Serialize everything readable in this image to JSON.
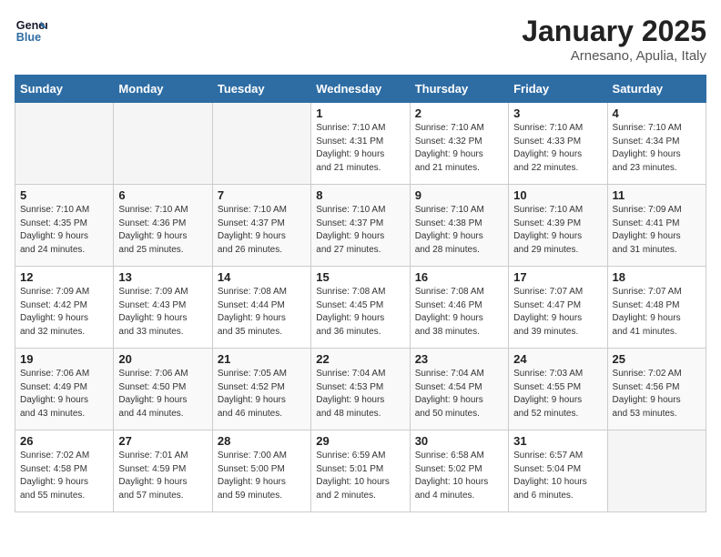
{
  "header": {
    "logo_line1": "General",
    "logo_line2": "Blue",
    "month": "January 2025",
    "location": "Arnesano, Apulia, Italy"
  },
  "weekdays": [
    "Sunday",
    "Monday",
    "Tuesday",
    "Wednesday",
    "Thursday",
    "Friday",
    "Saturday"
  ],
  "weeks": [
    [
      {
        "day": "",
        "info": ""
      },
      {
        "day": "",
        "info": ""
      },
      {
        "day": "",
        "info": ""
      },
      {
        "day": "1",
        "info": "Sunrise: 7:10 AM\nSunset: 4:31 PM\nDaylight: 9 hours\nand 21 minutes."
      },
      {
        "day": "2",
        "info": "Sunrise: 7:10 AM\nSunset: 4:32 PM\nDaylight: 9 hours\nand 21 minutes."
      },
      {
        "day": "3",
        "info": "Sunrise: 7:10 AM\nSunset: 4:33 PM\nDaylight: 9 hours\nand 22 minutes."
      },
      {
        "day": "4",
        "info": "Sunrise: 7:10 AM\nSunset: 4:34 PM\nDaylight: 9 hours\nand 23 minutes."
      }
    ],
    [
      {
        "day": "5",
        "info": "Sunrise: 7:10 AM\nSunset: 4:35 PM\nDaylight: 9 hours\nand 24 minutes."
      },
      {
        "day": "6",
        "info": "Sunrise: 7:10 AM\nSunset: 4:36 PM\nDaylight: 9 hours\nand 25 minutes."
      },
      {
        "day": "7",
        "info": "Sunrise: 7:10 AM\nSunset: 4:37 PM\nDaylight: 9 hours\nand 26 minutes."
      },
      {
        "day": "8",
        "info": "Sunrise: 7:10 AM\nSunset: 4:37 PM\nDaylight: 9 hours\nand 27 minutes."
      },
      {
        "day": "9",
        "info": "Sunrise: 7:10 AM\nSunset: 4:38 PM\nDaylight: 9 hours\nand 28 minutes."
      },
      {
        "day": "10",
        "info": "Sunrise: 7:10 AM\nSunset: 4:39 PM\nDaylight: 9 hours\nand 29 minutes."
      },
      {
        "day": "11",
        "info": "Sunrise: 7:09 AM\nSunset: 4:41 PM\nDaylight: 9 hours\nand 31 minutes."
      }
    ],
    [
      {
        "day": "12",
        "info": "Sunrise: 7:09 AM\nSunset: 4:42 PM\nDaylight: 9 hours\nand 32 minutes."
      },
      {
        "day": "13",
        "info": "Sunrise: 7:09 AM\nSunset: 4:43 PM\nDaylight: 9 hours\nand 33 minutes."
      },
      {
        "day": "14",
        "info": "Sunrise: 7:08 AM\nSunset: 4:44 PM\nDaylight: 9 hours\nand 35 minutes."
      },
      {
        "day": "15",
        "info": "Sunrise: 7:08 AM\nSunset: 4:45 PM\nDaylight: 9 hours\nand 36 minutes."
      },
      {
        "day": "16",
        "info": "Sunrise: 7:08 AM\nSunset: 4:46 PM\nDaylight: 9 hours\nand 38 minutes."
      },
      {
        "day": "17",
        "info": "Sunrise: 7:07 AM\nSunset: 4:47 PM\nDaylight: 9 hours\nand 39 minutes."
      },
      {
        "day": "18",
        "info": "Sunrise: 7:07 AM\nSunset: 4:48 PM\nDaylight: 9 hours\nand 41 minutes."
      }
    ],
    [
      {
        "day": "19",
        "info": "Sunrise: 7:06 AM\nSunset: 4:49 PM\nDaylight: 9 hours\nand 43 minutes."
      },
      {
        "day": "20",
        "info": "Sunrise: 7:06 AM\nSunset: 4:50 PM\nDaylight: 9 hours\nand 44 minutes."
      },
      {
        "day": "21",
        "info": "Sunrise: 7:05 AM\nSunset: 4:52 PM\nDaylight: 9 hours\nand 46 minutes."
      },
      {
        "day": "22",
        "info": "Sunrise: 7:04 AM\nSunset: 4:53 PM\nDaylight: 9 hours\nand 48 minutes."
      },
      {
        "day": "23",
        "info": "Sunrise: 7:04 AM\nSunset: 4:54 PM\nDaylight: 9 hours\nand 50 minutes."
      },
      {
        "day": "24",
        "info": "Sunrise: 7:03 AM\nSunset: 4:55 PM\nDaylight: 9 hours\nand 52 minutes."
      },
      {
        "day": "25",
        "info": "Sunrise: 7:02 AM\nSunset: 4:56 PM\nDaylight: 9 hours\nand 53 minutes."
      }
    ],
    [
      {
        "day": "26",
        "info": "Sunrise: 7:02 AM\nSunset: 4:58 PM\nDaylight: 9 hours\nand 55 minutes."
      },
      {
        "day": "27",
        "info": "Sunrise: 7:01 AM\nSunset: 4:59 PM\nDaylight: 9 hours\nand 57 minutes."
      },
      {
        "day": "28",
        "info": "Sunrise: 7:00 AM\nSunset: 5:00 PM\nDaylight: 9 hours\nand 59 minutes."
      },
      {
        "day": "29",
        "info": "Sunrise: 6:59 AM\nSunset: 5:01 PM\nDaylight: 10 hours\nand 2 minutes."
      },
      {
        "day": "30",
        "info": "Sunrise: 6:58 AM\nSunset: 5:02 PM\nDaylight: 10 hours\nand 4 minutes."
      },
      {
        "day": "31",
        "info": "Sunrise: 6:57 AM\nSunset: 5:04 PM\nDaylight: 10 hours\nand 6 minutes."
      },
      {
        "day": "",
        "info": ""
      }
    ]
  ]
}
